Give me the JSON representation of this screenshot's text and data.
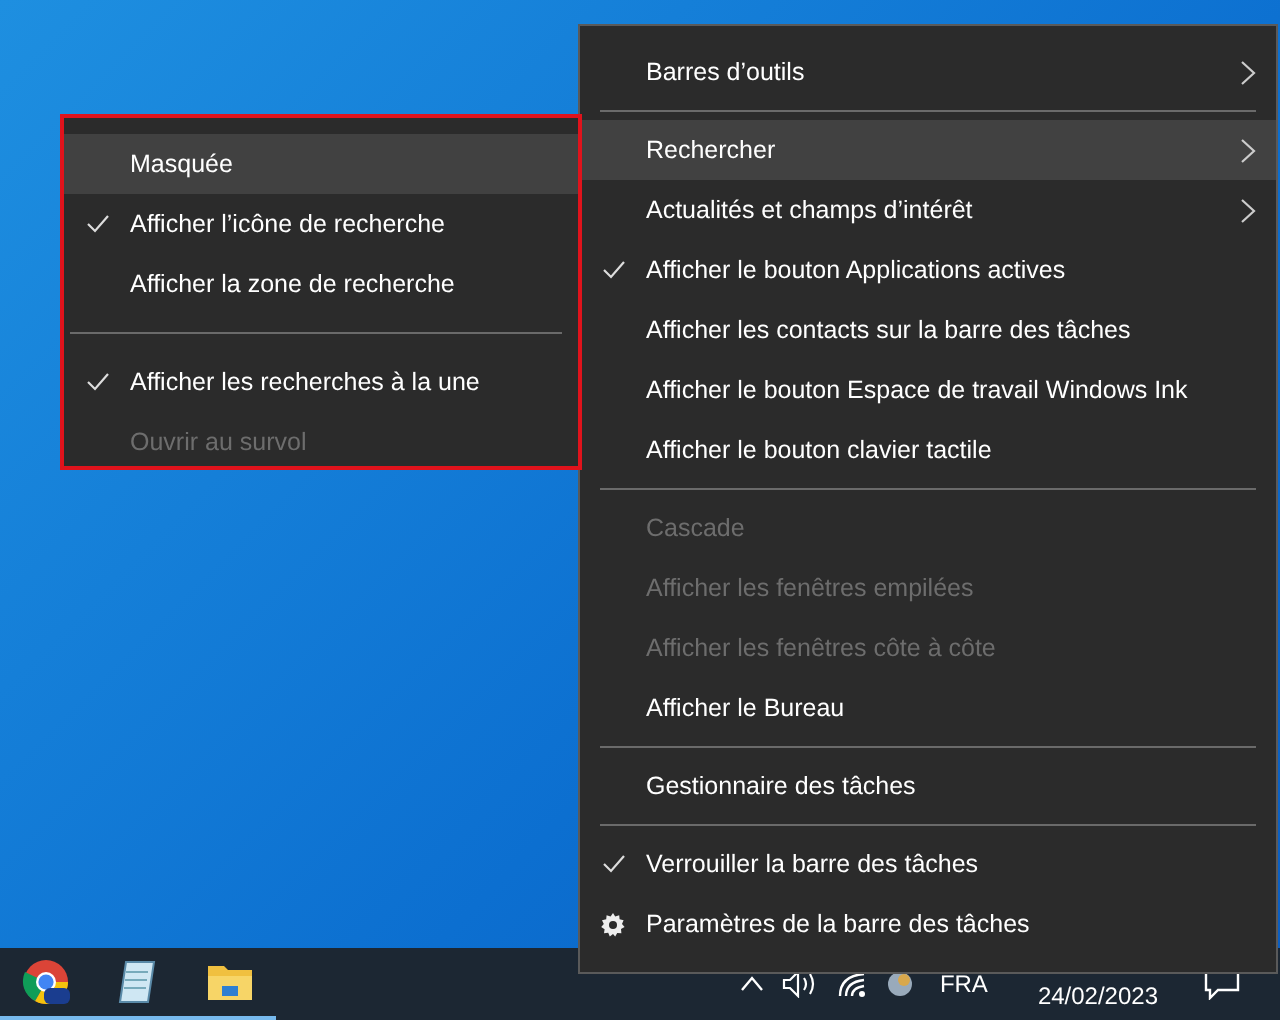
{
  "taskbar": {
    "apps": [
      {
        "kind": "browser",
        "running": true
      },
      {
        "kind": "notepad",
        "running": true
      },
      {
        "kind": "folder",
        "running": true
      }
    ],
    "tray": {
      "language": "FRA",
      "date": "24/02/2023"
    }
  },
  "context_menu": {
    "items": [
      {
        "kind": "item",
        "label": "Barres d’outils",
        "checked": false,
        "disabled": false,
        "submenu": true,
        "selected": false
      },
      {
        "kind": "separator"
      },
      {
        "kind": "item",
        "label": "Rechercher",
        "checked": false,
        "disabled": false,
        "submenu": true,
        "selected": true
      },
      {
        "kind": "item",
        "label": "Actualités et champs d’intérêt",
        "checked": false,
        "disabled": false,
        "submenu": true,
        "selected": false
      },
      {
        "kind": "item",
        "label": "Afficher le bouton Applications actives",
        "checked": true,
        "disabled": false,
        "submenu": false,
        "selected": false
      },
      {
        "kind": "item",
        "label": "Afficher les contacts sur la barre des tâches",
        "checked": false,
        "disabled": false,
        "submenu": false,
        "selected": false
      },
      {
        "kind": "item",
        "label": "Afficher le bouton Espace de travail Windows Ink",
        "checked": false,
        "disabled": false,
        "submenu": false,
        "selected": false
      },
      {
        "kind": "item",
        "label": "Afficher le bouton clavier tactile",
        "checked": false,
        "disabled": false,
        "submenu": false,
        "selected": false
      },
      {
        "kind": "separator"
      },
      {
        "kind": "item",
        "label": "Cascade",
        "checked": false,
        "disabled": true,
        "submenu": false,
        "selected": false
      },
      {
        "kind": "item",
        "label": "Afficher les fenêtres empilées",
        "checked": false,
        "disabled": true,
        "submenu": false,
        "selected": false
      },
      {
        "kind": "item",
        "label": "Afficher les fenêtres côte à côte",
        "checked": false,
        "disabled": true,
        "submenu": false,
        "selected": false
      },
      {
        "kind": "item",
        "label": "Afficher le Bureau",
        "checked": false,
        "disabled": false,
        "submenu": false,
        "selected": false
      },
      {
        "kind": "separator"
      },
      {
        "kind": "item",
        "label": "Gestionnaire des tâches",
        "checked": false,
        "disabled": false,
        "submenu": false,
        "selected": false
      },
      {
        "kind": "separator"
      },
      {
        "kind": "item",
        "label": "Verrouiller la barre des tâches",
        "checked": true,
        "disabled": false,
        "submenu": false,
        "selected": false
      },
      {
        "kind": "settings",
        "label": "Paramètres de la barre des tâches",
        "checked": false,
        "disabled": false,
        "submenu": false,
        "selected": false
      }
    ]
  },
  "submenu": {
    "outlined": true,
    "items": [
      {
        "kind": "item",
        "label": "Masquée",
        "checked": false,
        "disabled": false,
        "selected": true
      },
      {
        "kind": "item",
        "label": "Afficher l’icône de recherche",
        "checked": true,
        "disabled": false,
        "selected": false
      },
      {
        "kind": "item",
        "label": "Afficher la zone de recherche",
        "checked": false,
        "disabled": false,
        "selected": false
      },
      {
        "kind": "separator"
      },
      {
        "kind": "item",
        "label": "Afficher les recherches à la une",
        "checked": true,
        "disabled": false,
        "selected": false
      },
      {
        "kind": "item",
        "label": "Ouvrir au survol",
        "checked": false,
        "disabled": true,
        "selected": false
      }
    ]
  }
}
